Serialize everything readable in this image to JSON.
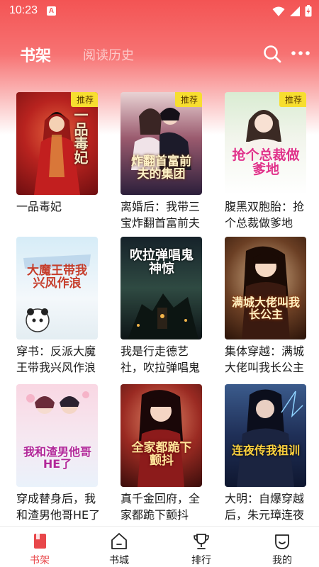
{
  "status_bar": {
    "time": "10:23",
    "notification_letter": "A"
  },
  "header": {
    "tabs": [
      {
        "label": "书架",
        "active": true
      },
      {
        "label": "阅读历史",
        "active": false
      }
    ],
    "search_icon": "search-icon",
    "more_icon": "more-dots-icon"
  },
  "books": [
    {
      "title": "一品毒妃",
      "badge": "推荐",
      "cover_text": "一品毒妃"
    },
    {
      "title": "离婚后：我带三宝炸翻首富前夫的集团",
      "badge": "推荐",
      "cover_text": "炸翻首富前夫的集团"
    },
    {
      "title": "腹黑双胞胎：抢个总裁做爹地",
      "badge": "推荐",
      "cover_text": "抢个总裁做爹地"
    },
    {
      "title": "穿书：反派大魔王带我兴风作浪",
      "badge": "",
      "cover_text": "大魔王带我兴风作浪"
    },
    {
      "title": "我是行走德艺社，吹拉弹唱鬼神惊",
      "badge": "",
      "cover_text": "吹拉弹唱鬼神惊"
    },
    {
      "title": "集体穿越：满城大佬叫我长公主",
      "badge": "",
      "cover_text": "满城大佬叫我长公主"
    },
    {
      "title": "穿成替身后，我和渣男他哥HE了",
      "badge": "",
      "cover_text": "我和渣男他哥HE了"
    },
    {
      "title": "真千金回府，全家都跪下颤抖",
      "badge": "",
      "cover_text": "全家都跪下颤抖"
    },
    {
      "title": "大明：自爆穿越后，朱元璋连夜传我祖训",
      "badge": "",
      "cover_text": "连夜传我祖训"
    }
  ],
  "bottom_nav": [
    {
      "label": "书架",
      "icon": "bookshelf-icon",
      "active": true
    },
    {
      "label": "书城",
      "icon": "bookstore-icon",
      "active": false
    },
    {
      "label": "排行",
      "icon": "trophy-icon",
      "active": false
    },
    {
      "label": "我的",
      "icon": "profile-icon",
      "active": false
    }
  ],
  "colors": {
    "header_red": "#f35454",
    "badge_yellow": "#f7de2f",
    "active_red": "#e8474a"
  }
}
